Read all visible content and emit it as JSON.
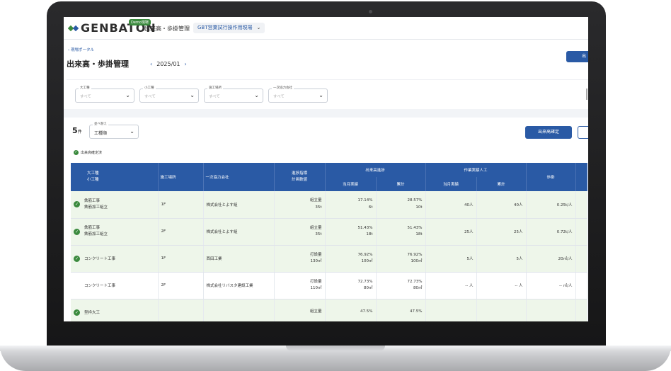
{
  "header": {
    "logo_text": "GENBATON",
    "demo_badge": "Demo現場",
    "app_title": "出来高・歩掛管理",
    "site_name": "GBT営業試行操作用現場",
    "site_chevron": "⌄"
  },
  "page": {
    "back_link": "現場ポータル",
    "title": "出来高・歩掛管理",
    "month": "2025/01",
    "prev_arrow": "‹",
    "next_arrow": "›",
    "top_button": "出"
  },
  "filters": [
    {
      "label": "大工種",
      "value": "すべて"
    },
    {
      "label": "小工種",
      "value": "すべて"
    },
    {
      "label": "施工場所",
      "value": "すべて"
    },
    {
      "label": "一次協力会社",
      "value": "すべて"
    }
  ],
  "list": {
    "count": "5",
    "count_unit": "件",
    "sort_label": "並べ替え",
    "sort_value": "工種順",
    "confirm_button": "出来高確定",
    "legend": "出来高確定済"
  },
  "table": {
    "headers": {
      "work": "大工種",
      "subwork": "小工種",
      "location": "施工場所",
      "company": "一次協力会社",
      "progress_metric": "進捗指標",
      "planned_qty": "計画数値",
      "output_rate": "出来高進捗",
      "labor": "作業実績人工",
      "output_today": "当月実績",
      "output_total": "累計",
      "labor_today": "当月実績",
      "labor_total": "累計",
      "productivity": "歩掛"
    },
    "rows": [
      {
        "confirmed": true,
        "work": "鉄筋工事",
        "subwork": "鉄筋加工組立",
        "location": "1F",
        "company": "株式会社とよす組",
        "metric": "組立量",
        "planned": "35t",
        "out_pct": "17.14%",
        "out_val": "6t",
        "cum_pct": "28.57%",
        "cum_val": "10t",
        "labor_m": "40人",
        "labor_c": "40人",
        "prod": "0.25t/人"
      },
      {
        "confirmed": true,
        "work": "鉄筋工事",
        "subwork": "鉄筋加工組立",
        "location": "2F",
        "company": "株式会社とよす組",
        "metric": "組立量",
        "planned": "35t",
        "out_pct": "51.43%",
        "out_val": "18t",
        "cum_pct": "51.43%",
        "cum_val": "18t",
        "labor_m": "25人",
        "labor_c": "25人",
        "prod": "0.72t/人"
      },
      {
        "confirmed": true,
        "work": "コンクリート工事",
        "subwork": "",
        "location": "1F",
        "company": "西田工業",
        "metric": "打設量",
        "planned": "130㎥",
        "out_pct": "76.92%",
        "out_val": "100㎥",
        "cum_pct": "76.92%",
        "cum_val": "100㎥",
        "labor_m": "5人",
        "labor_c": "5人",
        "prod": "20㎥/人"
      },
      {
        "confirmed": false,
        "work": "コンクリート工事",
        "subwork": "",
        "location": "2F",
        "company": "株式会社リバスタ建設工業",
        "metric": "打設量",
        "planned": "110㎥",
        "out_pct": "72.73%",
        "out_val": "80㎥",
        "cum_pct": "72.73%",
        "cum_val": "80㎥",
        "labor_m": "-- 人",
        "labor_c": "-- 人",
        "prod": "-- ㎥/人"
      },
      {
        "confirmed": true,
        "work": "型枠大工",
        "subwork": "",
        "location": "",
        "company": "",
        "metric": "組立量",
        "planned": "",
        "out_pct": "47.5%",
        "out_val": "",
        "cum_pct": "47.5%",
        "cum_val": "",
        "labor_m": "",
        "labor_c": "",
        "prod": ""
      }
    ]
  },
  "colors": {
    "primary": "#2a5aa5",
    "confirmed_row": "#eef6ea",
    "check": "#3b8a3e"
  }
}
